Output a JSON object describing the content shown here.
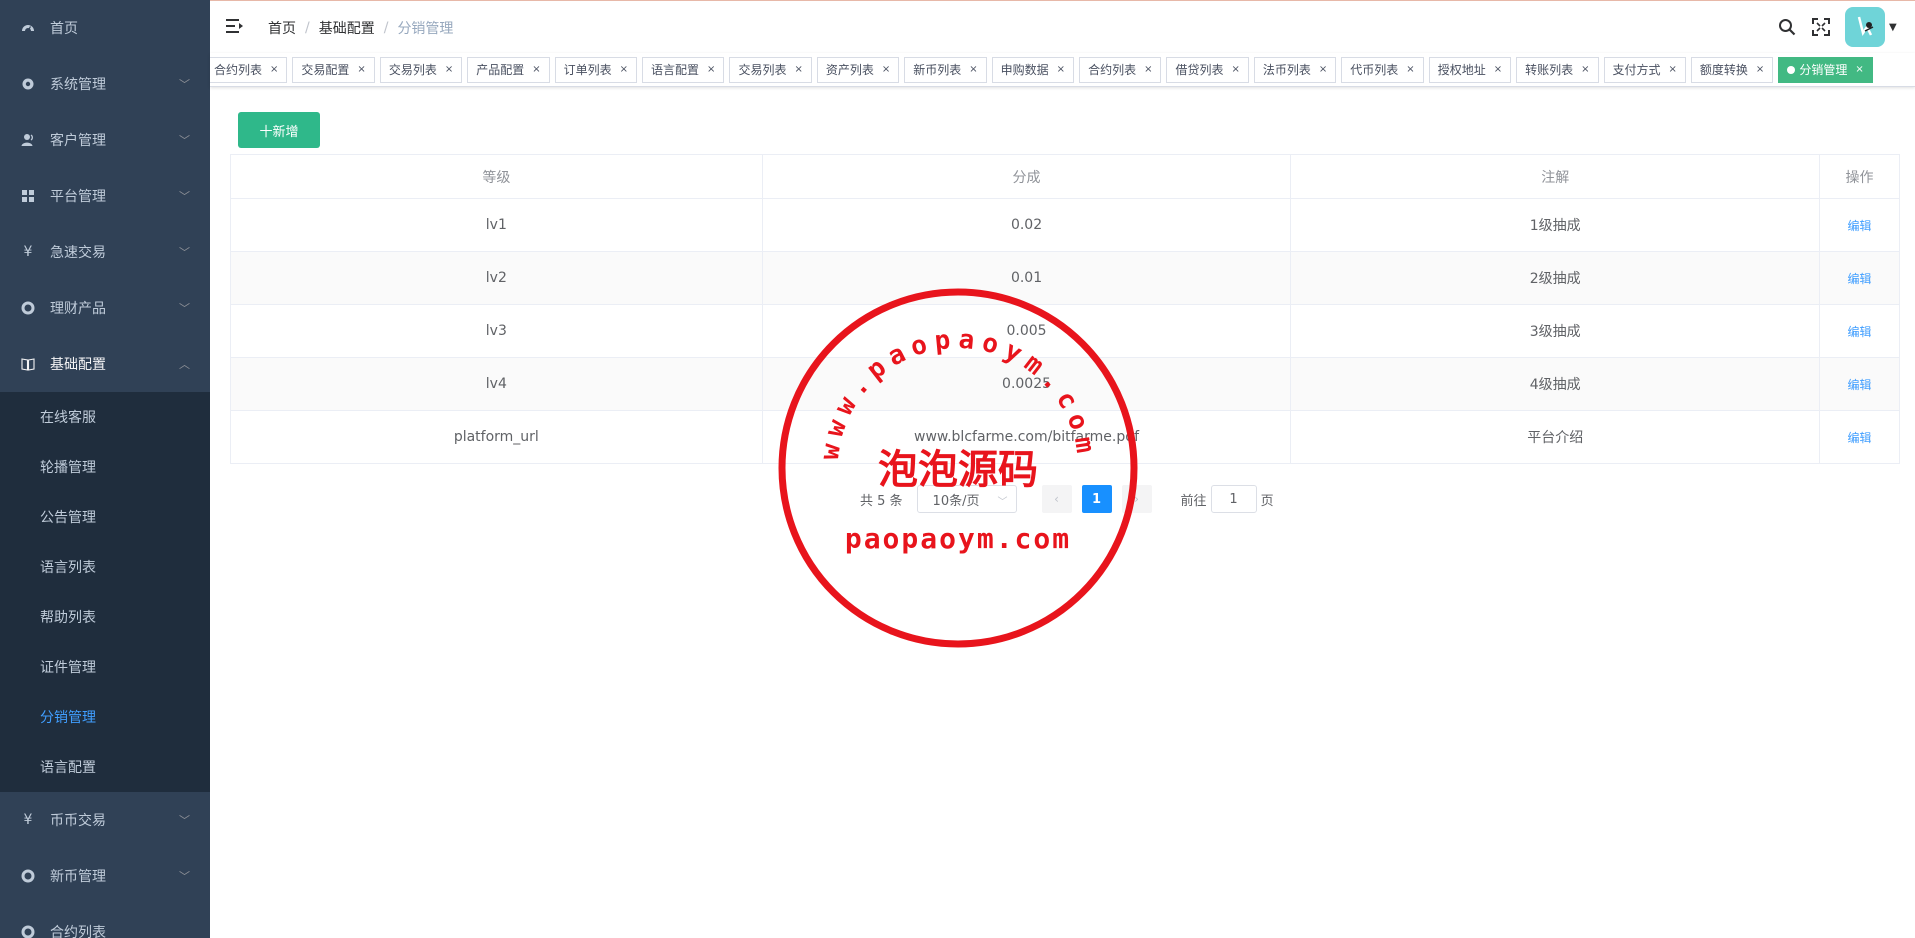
{
  "sidebar": {
    "items": [
      {
        "label": "首页"
      },
      {
        "label": "系统管理"
      },
      {
        "label": "客户管理"
      },
      {
        "label": "平台管理"
      },
      {
        "label": "急速交易"
      },
      {
        "label": "理财产品"
      },
      {
        "label": "基础配置"
      }
    ],
    "submenu": [
      {
        "label": "在线客服"
      },
      {
        "label": "轮播管理"
      },
      {
        "label": "公告管理"
      },
      {
        "label": "语言列表"
      },
      {
        "label": "帮助列表"
      },
      {
        "label": "证件管理"
      },
      {
        "label": "分销管理"
      },
      {
        "label": "语言配置"
      }
    ],
    "after": [
      {
        "label": "币币交易"
      },
      {
        "label": "新币管理"
      },
      {
        "label": "合约列表"
      }
    ]
  },
  "header": {
    "breadcrumb": [
      "首页",
      "基础配置",
      "分销管理"
    ]
  },
  "tags": [
    "合约列表",
    "交易配置",
    "交易列表",
    "产品配置",
    "订单列表",
    "语言配置",
    "交易列表",
    "资产列表",
    "新币列表",
    "申购数据",
    "合约列表",
    "借贷列表",
    "法币列表",
    "代币列表",
    "授权地址",
    "转账列表",
    "支付方式",
    "额度转换",
    "分销管理"
  ],
  "toolbar": {
    "add_label": "十新增"
  },
  "table": {
    "headers": [
      "等级",
      "分成",
      "注解",
      "操作"
    ],
    "rows": [
      {
        "level": "lv1",
        "rate": "0.02",
        "note": "1级抽成",
        "action": "编辑"
      },
      {
        "level": "lv2",
        "rate": "0.01",
        "note": "2级抽成",
        "action": "编辑"
      },
      {
        "level": "lv3",
        "rate": "0.005",
        "note": "3级抽成",
        "action": "编辑"
      },
      {
        "level": "lv4",
        "rate": "0.0025",
        "note": "4级抽成",
        "action": "编辑"
      },
      {
        "level": "platform_url",
        "rate": "www.blcfarme.com/bitfarme.pdf",
        "note": "平台介绍",
        "action": "编辑"
      }
    ]
  },
  "pagination": {
    "total": "共 5 条",
    "page_size": "10条/页",
    "current_page": "1",
    "goto_prefix": "前往",
    "goto_value": "1",
    "goto_suffix": "页"
  },
  "watermark": {
    "arc_text": "www.paopaoym.com",
    "center_text": "泡泡源码",
    "bottom_text": "paopaoym.com",
    "color": "#e8141c"
  },
  "colors": {
    "sidebar_bg": "#304156",
    "submenu_bg": "#1f2d3d",
    "active_link": "#409eff",
    "tag_active": "#42b983",
    "add_button": "#2fb88a"
  }
}
